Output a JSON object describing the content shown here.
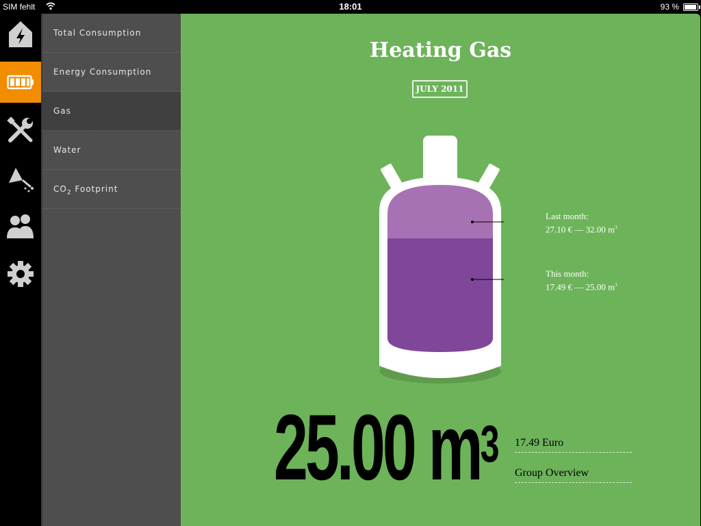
{
  "status_bar": {
    "carrier": "SIM fehlt",
    "time": "18:01",
    "battery": "93 %"
  },
  "rail": {
    "items": [
      {
        "icon": "house-lightning-icon",
        "active": false
      },
      {
        "icon": "battery-icon",
        "active": true
      },
      {
        "icon": "tools-icon",
        "active": false
      },
      {
        "icon": "shower-icon",
        "active": false
      },
      {
        "icon": "people-icon",
        "active": false
      },
      {
        "icon": "gear-icon",
        "active": false
      }
    ]
  },
  "submenu": {
    "items": [
      {
        "label": "Total Consumption"
      },
      {
        "label": "Energy Consumption"
      },
      {
        "label": "Gas"
      },
      {
        "label": "Water"
      },
      {
        "label": "CO",
        "sub": "2",
        "suffix": " Footprint"
      }
    ],
    "active_index": 2
  },
  "main": {
    "title": "Heating Gas",
    "date": "JULY 2011",
    "colors": {
      "background": "#6db35a",
      "last_month_fill": "#a772b3",
      "this_month_fill": "#80469a",
      "accent": "#f28c00"
    },
    "last_month": {
      "label": "Last month:",
      "value": "27.10 € — 32.00 m",
      "unit_exp": "3"
    },
    "this_month": {
      "label": "This month:",
      "value": "17.49 € — 25.00 m",
      "unit_exp": "3"
    },
    "big_value": "25.00 m",
    "big_value_exp": "3",
    "cost": "17.49 Euro",
    "group_link": "Group Overview"
  }
}
